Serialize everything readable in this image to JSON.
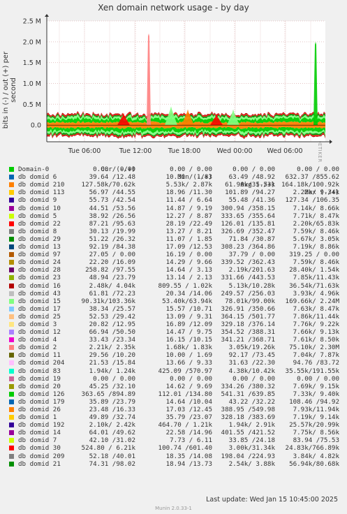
{
  "title": "Xen domain network usage - by day",
  "y_axis_label": "bits in (-) / out (+) per second",
  "credit": "RRDTOOL / TOBI OETIKER",
  "last_update": "Last update:  Wed Jan 15 10:45:00 2025",
  "munin_version": "Munin 2.0.33-1",
  "legend_headers": {
    "cur": "Cur (-/+)",
    "min": "Min (-/+)",
    "avg": "Avg (-/+)",
    "max": "Max (-/+)"
  },
  "chart_data": {
    "type": "area",
    "title": "Xen domain network usage - by day",
    "ylabel": "bits in (-) / out (+) per second",
    "y_ticks": [
      "2.5 M",
      "2.0 M",
      "1.5 M",
      "1.0 M",
      "0.5 M",
      "0.0"
    ],
    "y_tick_values": [
      2500000,
      2000000,
      1500000,
      1000000,
      500000,
      0
    ],
    "ylim": [
      -400000,
      2500000
    ],
    "x_ticks": [
      "Tue 06:00",
      "Tue 12:00",
      "Tue 18:00",
      "Wed 00:00",
      "Wed 06:00"
    ],
    "grid": true,
    "spikes": [
      {
        "x": "Tue 11:00",
        "series": "db domid 22",
        "value_bits": 300000
      },
      {
        "x": "Tue 13:00",
        "series": "db domid 2",
        "value_bits": 2200000
      },
      {
        "x": "Tue 16:00",
        "series": "db domid 15",
        "value_bits": 450000
      },
      {
        "x": "Tue 18:30",
        "series": "db domid 210",
        "value_bits": 380000
      },
      {
        "x": "Tue 23:00",
        "series": "db domid 22",
        "value_bits": 280000
      },
      {
        "x": "Wed 00:30",
        "series": "db domid 15",
        "value_bits": 380000
      },
      {
        "x": "Wed 08:30",
        "series": "db domid 126",
        "value_bits": 2000000
      }
    ],
    "series": [
      {
        "name": "Domain-0",
        "color": "#00cc00",
        "cur": "0.00 / 0.00",
        "min": "0.00 / 0.00",
        "avg": "0.00 / 0.00",
        "max": "0.00 / 0.00"
      },
      {
        "name": "db domid 6",
        "color": "#0066b3",
        "cur": "39.64 /12.48",
        "min": "10.30 / 1.83",
        "avg": "63.49 /48.92",
        "max": "632.37 /855.62"
      },
      {
        "name": "db domid 210",
        "color": "#ff8000",
        "cur": "127.58k/70.62k",
        "min": "5.53k/ 2.87k",
        "avg": "61.90k/35.53k",
        "max": "164.18k/100.92k"
      },
      {
        "name": "db domid 113",
        "color": "#ffcc00",
        "cur": "56.97 /44.55",
        "min": "18.96 /11.30",
        "avg": "101.89 /94.27",
        "max": "2.22k/ 9.34k"
      },
      {
        "name": "db domid 9",
        "color": "#330099",
        "cur": "55.73 /42.54",
        "min": "11.44 / 6.64",
        "avg": "55.48 /41.36",
        "max": "127.34 /106.35"
      },
      {
        "name": "db domid 10",
        "color": "#990099",
        "cur": "44.51 /53.56",
        "min": "14.87 / 9.19",
        "avg": "300.94 /358.15",
        "max": "7.14k/ 8.66k"
      },
      {
        "name": "db domid 5",
        "color": "#ccff00",
        "cur": "38.92 /26.56",
        "min": "12.27 / 8.87",
        "avg": "333.65 /355.64",
        "max": "7.71k/ 8.47k"
      },
      {
        "name": "db domid 22",
        "color": "#ff0000",
        "cur": "87.21 /95.63",
        "min": "28.19 /22.49",
        "avg": "126.01 /135.81",
        "max": "2.20k/65.83k"
      },
      {
        "name": "db domid 8",
        "color": "#808080",
        "cur": "30.13 /19.99",
        "min": "13.27 / 8.21",
        "avg": "326.69 /352.47",
        "max": "7.59k/ 8.46k"
      },
      {
        "name": "db domid 29",
        "color": "#008f00",
        "cur": "51.22 /26.32",
        "min": "11.07 / 1.85",
        "avg": "71.84 /30.87",
        "max": "5.67k/ 3.05k"
      },
      {
        "name": "db domid 13",
        "color": "#00487d",
        "cur": "92.19 /84.38",
        "min": "17.09 /12.53",
        "avg": "308.23 /364.86",
        "max": "7.19k/ 8.86k"
      },
      {
        "name": "db domid 97",
        "color": "#b35a00",
        "cur": "27.05 / 0.00",
        "min": "16.19 / 0.00",
        "avg": "37.79 / 0.00",
        "max": "319.25 / 0.00"
      },
      {
        "name": "db domid 24",
        "color": "#b38f00",
        "cur": "22.20 /16.09",
        "min": "14.29 / 9.66",
        "avg": "339.52 /362.43",
        "max": "7.59k/ 8.46k"
      },
      {
        "name": "db domid 28",
        "color": "#6b006b",
        "cur": "258.82 /97.55",
        "min": "14.64 / 3.13",
        "avg": "2.19k/201.63",
        "max": "28.40k/ 1.54k"
      },
      {
        "name": "db domid 23",
        "color": "#8fb300",
        "cur": "48.94 /23.79",
        "min": "13.14 / 2.13",
        "avg": "331.66 /443.53",
        "max": "7.85k/11.43k"
      },
      {
        "name": "db domid 16",
        "color": "#b30000",
        "cur": "2.48k/ 4.04k",
        "min": "809.55 / 1.02k",
        "avg": "5.13k/10.28k",
        "max": "36.54k/71.63k"
      },
      {
        "name": "db domid 43",
        "color": "#bebebe",
        "cur": "61.81 /72.23",
        "min": "20.34 /14.06",
        "avg": "249.57 /256.03",
        "max": "3.93k/ 4.96k"
      },
      {
        "name": "db domid 15",
        "color": "#80ff80",
        "cur": "90.31k/103.36k",
        "min": "53.40k/63.94k",
        "avg": "78.01k/99.00k",
        "max": "169.66k/ 2.24M"
      },
      {
        "name": "db domid 17",
        "color": "#80c9ff",
        "cur": "38.34 /25.57",
        "min": "15.57 /10.71",
        "avg": "326.91 /350.66",
        "max": "7.63k/ 8.47k"
      },
      {
        "name": "db domid 25",
        "color": "#ffc080",
        "cur": "52.53 /29.42",
        "min": "13.09 / 9.31",
        "avg": "364.15 /501.77",
        "max": "7.86k/11.44k"
      },
      {
        "name": "db domid 3",
        "color": "#ffe680",
        "cur": "20.82 /12.95",
        "min": "16.89 /12.09",
        "avg": "329.18 /376.14",
        "max": "7.76k/ 9.22k"
      },
      {
        "name": "db domid 12",
        "color": "#aa80ff",
        "cur": "66.94 /50.50",
        "min": "14.47 / 9.75",
        "avg": "354.52 /388.31",
        "max": "7.66k/ 9.13k"
      },
      {
        "name": "db domid 4",
        "color": "#ee00cc",
        "cur": "33.43 /23.34",
        "min": "16.15 /10.15",
        "avg": "341.21 /368.71",
        "max": "7.61k/ 8.50k"
      },
      {
        "name": "db domid 2",
        "color": "#ff8080",
        "cur": "2.21k/ 2.35k",
        "min": "1.68k/ 1.83k",
        "avg": "3.05k/19.26k",
        "max": "75.10k/ 2.30M"
      },
      {
        "name": "db domid 11",
        "color": "#666600",
        "cur": "29.56 /10.20",
        "min": "10.00 / 1.69",
        "avg": "92.17 /73.45",
        "max": "7.04k/ 7.87k"
      },
      {
        "name": "db domid 204",
        "color": "#ffbfff",
        "cur": "21.53 /15.84",
        "min": "13.66 / 9.33",
        "avg": "31.63 /22.30",
        "max": "94.76 /83.72"
      },
      {
        "name": "db domid 83",
        "color": "#00ffcc",
        "cur": "1.94k/ 1.24k",
        "min": "425.09 /570.97",
        "avg": "4.38k/10.42k",
        "max": "35.55k/191.55k"
      },
      {
        "name": "db domid 19",
        "color": "#cc6699",
        "cur": "0.00 / 0.00",
        "min": "0.00 / 0.00",
        "avg": "0.00 / 0.00",
        "max": "0.00 / 0.00"
      },
      {
        "name": "db domid 20",
        "color": "#999900",
        "cur": "45.25 /32.10",
        "min": "14.62 / 9.69",
        "avg": "334.26 /380.32",
        "max": "7.69k/ 9.15k"
      },
      {
        "name": "db domid 126",
        "color": "#00cc00",
        "cur": "363.65 /894.89",
        "min": "112.01 /134.80",
        "avg": "541.31 /639.85",
        "max": "7.33k/ 9.40k"
      },
      {
        "name": "db domid 179",
        "color": "#0066b3",
        "cur": "35.89 /23.79",
        "min": "14.64 /10.04",
        "avg": "43.22 /32.22",
        "max": "108.46 /94.92"
      },
      {
        "name": "db domid 26",
        "color": "#ff8000",
        "cur": "23.48 /16.33",
        "min": "17.03 /12.45",
        "avg": "388.95 /549.98",
        "max": "7.93k/11.94k"
      },
      {
        "name": "db domid 1",
        "color": "#ffcc00",
        "cur": "49.89 /32.74",
        "min": "35.79 /23.07",
        "avg": "328.18 /383.69",
        "max": "7.19k/ 9.14k"
      },
      {
        "name": "db domid 192",
        "color": "#330099",
        "cur": "2.10k/ 2.42k",
        "min": "464.70 / 1.21k",
        "avg": "1.94k/ 2.91k",
        "max": "25.57k/20.99k"
      },
      {
        "name": "db domid 14",
        "color": "#990099",
        "cur": "64.01 /49.62",
        "min": "22.58 /14.96",
        "avg": "401.55 /421.52",
        "max": "7.75k/ 8.56k"
      },
      {
        "name": "db domid 7",
        "color": "#ccff00",
        "cur": "42.10 /31.02",
        "min": "7.73 / 6.11",
        "avg": "33.85 /24.18",
        "max": "83.94 /75.53"
      },
      {
        "name": "db domid 30",
        "color": "#ff0000",
        "cur": "524.80 / 6.21k",
        "min": "100.74 /601.40",
        "avg": "3.00k/31.34k",
        "max": "24.83k/766.89k"
      },
      {
        "name": "db domid 209",
        "color": "#808080",
        "cur": "52.18 /40.01",
        "min": "18.35 /14.08",
        "avg": "198.04 /224.93",
        "max": "3.84k/ 4.82k"
      },
      {
        "name": "db domid 21",
        "color": "#008f00",
        "cur": "74.31 /98.02",
        "min": "18.94 /13.73",
        "avg": "2.54k/ 3.88k",
        "max": "56.94k/80.68k"
      }
    ]
  }
}
